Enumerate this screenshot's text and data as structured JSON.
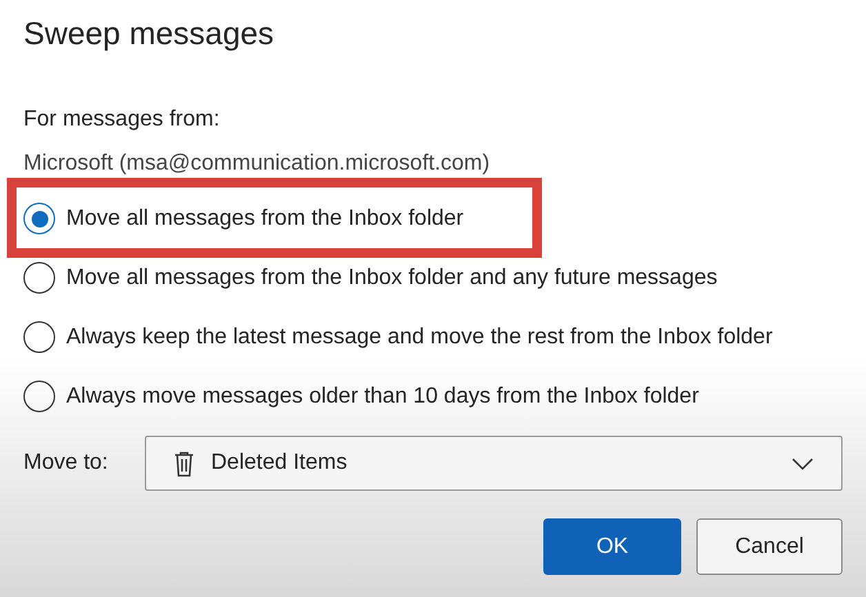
{
  "dialog": {
    "title": "Sweep messages",
    "sender_label": "For messages from:",
    "sender": "Microsoft (msa@communication.microsoft.com)",
    "options": [
      {
        "label": "Move all messages from the Inbox folder",
        "selected": true,
        "highlighted": true
      },
      {
        "label": "Move all messages from the Inbox folder and any future messages",
        "selected": false,
        "highlighted": false
      },
      {
        "label": "Always keep the latest message and move the rest from the Inbox folder",
        "selected": false,
        "highlighted": false
      },
      {
        "label": "Always move messages older than 10 days from the Inbox folder",
        "selected": false,
        "highlighted": false
      }
    ],
    "move_to": {
      "label": "Move to:",
      "value": "Deleted Items"
    },
    "buttons": [
      {
        "label": "OK",
        "kind": "primary"
      },
      {
        "label": "Cancel",
        "kind": "secondary"
      }
    ]
  }
}
